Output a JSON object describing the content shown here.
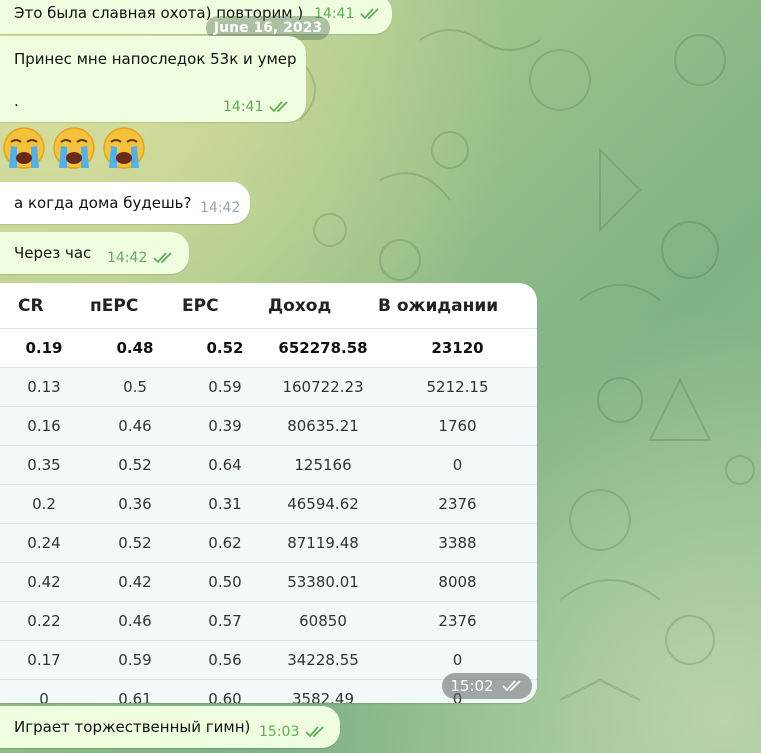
{
  "date_separator": "June 16, 2023",
  "messages": [
    {
      "text": "Это была славная охота) повторим )",
      "time": "14:41"
    },
    {
      "text": "Принес мне напоследок 53к и умер",
      "text2": ".",
      "time": "14:41"
    },
    {
      "text": "а когда дома будешь?",
      "time": "14:42"
    },
    {
      "text": "Через час",
      "time": "14:42"
    },
    {
      "text": "Играет торжественный гимн)",
      "time": "15:03"
    }
  ],
  "emoji": [
    "crying-face-emoji",
    "crying-face-emoji",
    "crying-face-emoji"
  ],
  "table_message": {
    "time": "15:02",
    "headers": [
      "CR",
      "пEPC",
      "EPC",
      "Доход",
      "В ожидании"
    ],
    "summary": [
      "0.19",
      "0.48",
      "0.52",
      "652278.58",
      "23120"
    ],
    "rows": [
      [
        "0.13",
        "0.5",
        "0.59",
        "160722.23",
        "5212.15"
      ],
      [
        "0.16",
        "0.46",
        "0.39",
        "80635.21",
        "1760"
      ],
      [
        "0.35",
        "0.52",
        "0.64",
        "125166",
        "0"
      ],
      [
        "0.2",
        "0.36",
        "0.31",
        "46594.62",
        "2376"
      ],
      [
        "0.24",
        "0.52",
        "0.62",
        "87119.48",
        "3388"
      ],
      [
        "0.42",
        "0.42",
        "0.50",
        "53380.01",
        "8008"
      ],
      [
        "0.22",
        "0.46",
        "0.57",
        "60850",
        "2376"
      ],
      [
        "0.17",
        "0.59",
        "0.56",
        "34228.55",
        "0"
      ],
      [
        "0",
        "0.61",
        "0.60",
        "3582.49",
        "0"
      ]
    ]
  },
  "colors": {
    "bubble_own": "#eefedf",
    "time_green": "#5fae54",
    "time_gray": "#9aa8a0"
  }
}
